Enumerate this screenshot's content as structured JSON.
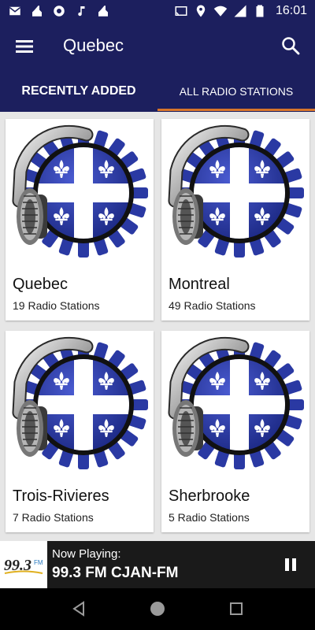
{
  "status_bar": {
    "time": "16:01",
    "left_icons": [
      "mail-icon",
      "cleaning-icon",
      "aperture-icon",
      "music-note-icon",
      "cleaning-icon-2"
    ],
    "right_icons": [
      "cast-icon",
      "location-icon",
      "wifi-icon",
      "signal-icon",
      "battery-icon"
    ]
  },
  "app_bar": {
    "title": "Quebec"
  },
  "tabs": [
    {
      "label": "RECENTLY ADDED",
      "selected": false
    },
    {
      "label": "ALL RADIO STATIONS",
      "selected": true
    }
  ],
  "cards": [
    {
      "name": "Quebec",
      "count": "19 Radio Stations"
    },
    {
      "name": "Montreal",
      "count": "49 Radio Stations"
    },
    {
      "name": "Trois-Rivieres",
      "count": "7 Radio Stations"
    },
    {
      "name": "Sherbrooke",
      "count": "5 Radio Stations"
    }
  ],
  "player": {
    "label": "Now Playing:",
    "station": "99.3 FM CJAN-FM",
    "logo_text": "99.3",
    "logo_suffix": "FM",
    "state": "playing"
  },
  "colors": {
    "primary": "#1c1f5e",
    "tab_indicator": "#d9762b",
    "flag_blue": "#2a39a3",
    "player_bg": "#1a1a1a"
  }
}
